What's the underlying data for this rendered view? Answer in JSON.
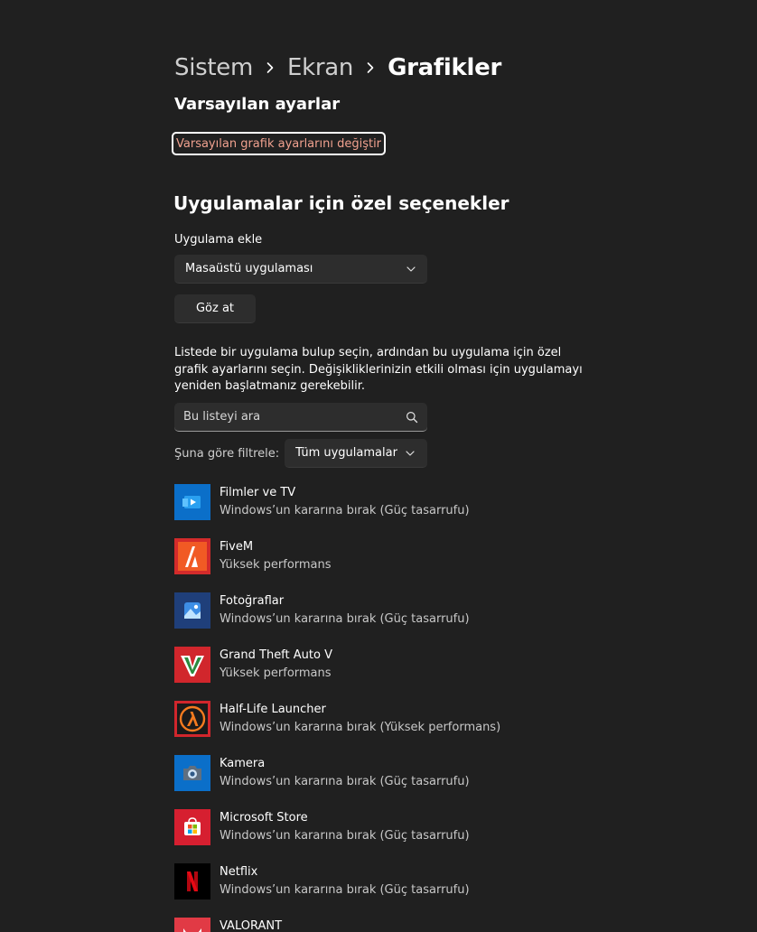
{
  "breadcrumb": {
    "items": [
      "Sistem",
      "Ekran",
      "Grafikler"
    ]
  },
  "default_section": {
    "title": "Varsayılan ayarlar",
    "change_link": "Varsayılan grafik ayarlarını değiştir"
  },
  "apps_section": {
    "title": "Uygulamalar için özel seçenekler",
    "add_label": "Uygulama ekle",
    "app_type_selected": "Masaüstü uygulaması",
    "browse_label": "Göz at",
    "description": "Listede bir uygulama bulup seçin, ardından bu uygulama için özel grafik ayarlarını seçin. Değişikliklerinizin etkili olması için uygulamayı yeniden başlatmanız gerekebilir.",
    "search_placeholder": "Bu listeyi ara",
    "filter_label": "Şuna göre filtrele:",
    "filter_selected": "Tüm uygulamalar"
  },
  "apps": [
    {
      "name": "Filmler ve TV",
      "setting": "Windows’un kararına bırak (Güç tasarrufu)",
      "icon": "movies-tv-icon",
      "color": "#0b6fc9"
    },
    {
      "name": "FiveM",
      "setting": "Yüksek performans",
      "icon": "fivem-icon",
      "color": "#e5512a"
    },
    {
      "name": "Fotoğraflar",
      "setting": "Windows’un kararına bırak (Güç tasarrufu)",
      "icon": "photos-icon",
      "color": "#1f3f7a"
    },
    {
      "name": "Grand Theft Auto V",
      "setting": "Yüksek performans",
      "icon": "gta-v-icon",
      "color": "#d1262c"
    },
    {
      "name": "Half-Life Launcher",
      "setting": "Windows’un kararına bırak (Yüksek performans)",
      "icon": "half-life-icon",
      "color": "#d1262c"
    },
    {
      "name": "Kamera",
      "setting": "Windows’un kararına bırak (Güç tasarrufu)",
      "icon": "camera-icon",
      "color": "#0b6fc9"
    },
    {
      "name": "Microsoft Store",
      "setting": "Windows’un kararına bırak (Güç tasarrufu)",
      "icon": "store-icon",
      "color": "#d61f30"
    },
    {
      "name": "Netflix",
      "setting": "Windows’un kararına bırak (Güç tasarrufu)",
      "icon": "netflix-icon",
      "color": "#000000"
    },
    {
      "name": "VALORANT",
      "setting": "",
      "icon": "valorant-icon",
      "color": "#e13a45"
    }
  ],
  "colors": {
    "background": "#202020",
    "control_bg": "#2d2d2d",
    "link_text": "#f0a18f"
  }
}
